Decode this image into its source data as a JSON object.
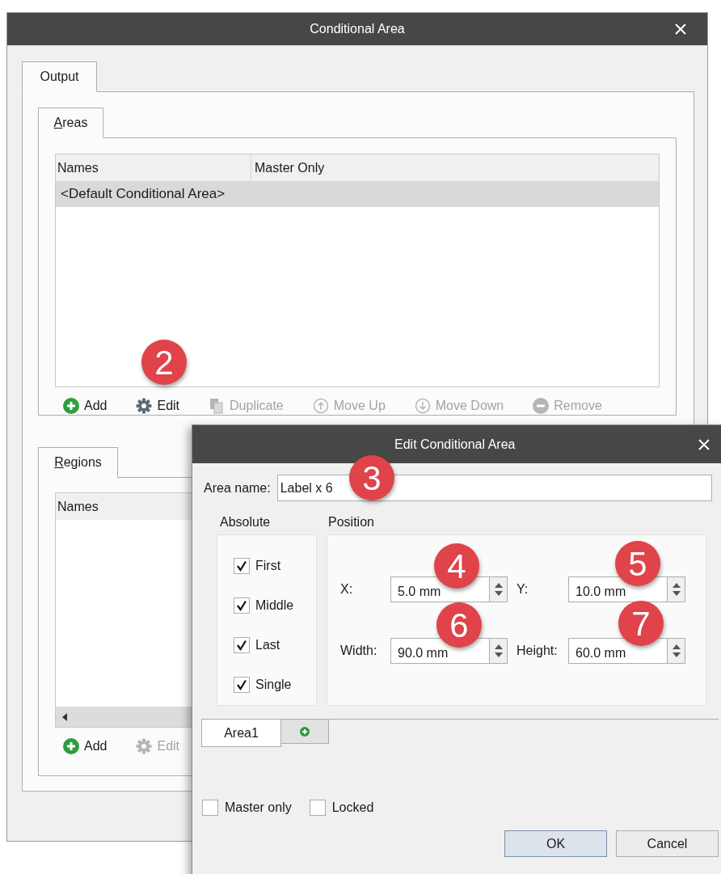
{
  "window": {
    "title": "Conditional Area"
  },
  "outer_tabs": [
    {
      "label": "Output",
      "selected": true
    }
  ],
  "areas": {
    "tab": {
      "label": "Areas",
      "selected": true
    },
    "columns": [
      "Names",
      "Master Only"
    ],
    "rows": [
      {
        "name": "<Default Conditional Area>",
        "selected": true
      }
    ],
    "toolbar": [
      {
        "kind": "add",
        "label": "Add",
        "disabled": false
      },
      {
        "kind": "edit",
        "label": "Edit",
        "disabled": false
      },
      {
        "kind": "duplicate",
        "label": "Duplicate",
        "disabled": true
      },
      {
        "kind": "up",
        "label": "Move Up",
        "disabled": true
      },
      {
        "kind": "down",
        "label": "Move Down",
        "disabled": true
      },
      {
        "kind": "remove",
        "label": "Remove",
        "disabled": true
      }
    ]
  },
  "regions": {
    "tab": {
      "label": "Regions",
      "selected": true
    },
    "columns": [
      "Names"
    ],
    "toolbar": [
      {
        "kind": "add",
        "label": "Add",
        "disabled": false
      },
      {
        "kind": "edit",
        "label": "Edit",
        "disabled": true
      }
    ]
  },
  "dialog": {
    "title": "Edit Conditional Area",
    "area_name": {
      "label": "Area name:",
      "value": "Label x 6"
    },
    "absolute": {
      "label": "Absolute",
      "options": [
        {
          "label": "First",
          "checked": true
        },
        {
          "label": "Middle",
          "checked": true
        },
        {
          "label": "Last",
          "checked": true
        },
        {
          "label": "Single",
          "checked": true
        }
      ]
    },
    "position": {
      "label": "Position",
      "fields": [
        {
          "label": "X:",
          "value": "5.0 mm"
        },
        {
          "label": "Y:",
          "value": "10.0 mm"
        },
        {
          "label": "Width:",
          "value": "90.0 mm"
        },
        {
          "label": "Height:",
          "value": "60.0 mm"
        }
      ]
    },
    "tabs": [
      {
        "label": "Area1",
        "selected": true
      }
    ],
    "options": [
      {
        "label": "Master only",
        "checked": false
      },
      {
        "label": "Locked",
        "checked": false
      }
    ],
    "buttons": [
      {
        "label": "OK",
        "default": true
      },
      {
        "label": "Cancel",
        "default": false
      }
    ]
  },
  "callouts": [
    "2",
    "3",
    "4",
    "5",
    "6",
    "7"
  ]
}
